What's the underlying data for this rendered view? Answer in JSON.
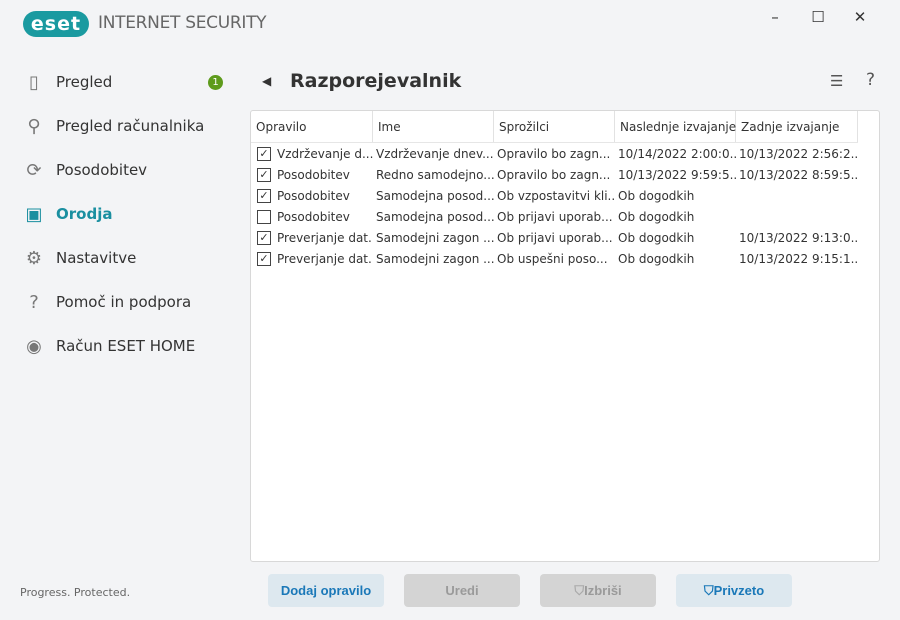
{
  "app": {
    "logo": "eset",
    "product": "INTERNET SECURITY",
    "tagline": "Progress. Protected."
  },
  "window": {
    "minimize": "–",
    "maximize": "☐",
    "close": "✕"
  },
  "sidebar": {
    "items": [
      {
        "label": "Pregled",
        "icon": "dashboard-icon",
        "badge": "1"
      },
      {
        "label": "Pregled računalnika",
        "icon": "search-icon"
      },
      {
        "label": "Posodobitev",
        "icon": "refresh-icon"
      },
      {
        "label": "Orodja",
        "icon": "toolbox-icon",
        "active": true
      },
      {
        "label": "Nastavitve",
        "icon": "gear-icon"
      },
      {
        "label": "Pomoč in podpora",
        "icon": "help-icon"
      },
      {
        "label": "Račun ESET HOME",
        "icon": "account-icon"
      }
    ]
  },
  "main": {
    "title": "Razporejevalnik",
    "help": "?"
  },
  "table": {
    "columns": [
      "Opravilo",
      "Ime",
      "Sprožilci",
      "Naslednje izvajanje",
      "Zadnje izvajanje"
    ],
    "rows": [
      {
        "checked": true,
        "cells": [
          "Vzdrževanje d...",
          "Vzdrževanje dnev...",
          "Opravilo bo zagn...",
          "10/14/2022 2:00:0...",
          "10/13/2022 2:56:2..."
        ]
      },
      {
        "checked": true,
        "cells": [
          "Posodobitev",
          "Redno samodejno...",
          "Opravilo bo zagn...",
          "10/13/2022 9:59:5...",
          "10/13/2022 8:59:5..."
        ]
      },
      {
        "checked": true,
        "cells": [
          "Posodobitev",
          "Samodejna posod...",
          "Ob vzpostavitvi kli...",
          "Ob dogodkih",
          ""
        ]
      },
      {
        "checked": false,
        "cells": [
          "Posodobitev",
          "Samodejna posod...",
          "Ob prijavi uporab...",
          "Ob dogodkih",
          ""
        ]
      },
      {
        "checked": true,
        "cells": [
          "Preverjanje dat...",
          "Samodejni zagon ...",
          "Ob prijavi uporab...",
          "Ob dogodkih",
          "10/13/2022 9:13:0..."
        ]
      },
      {
        "checked": true,
        "cells": [
          "Preverjanje dat...",
          "Samodejni zagon ...",
          "Ob uspešni poso...",
          "Ob dogodkih",
          "10/13/2022 9:15:1..."
        ]
      }
    ]
  },
  "buttons": {
    "add": "Dodaj opravilo",
    "edit": "Uredi",
    "delete": "Izbriši",
    "default": "Privzeto"
  }
}
